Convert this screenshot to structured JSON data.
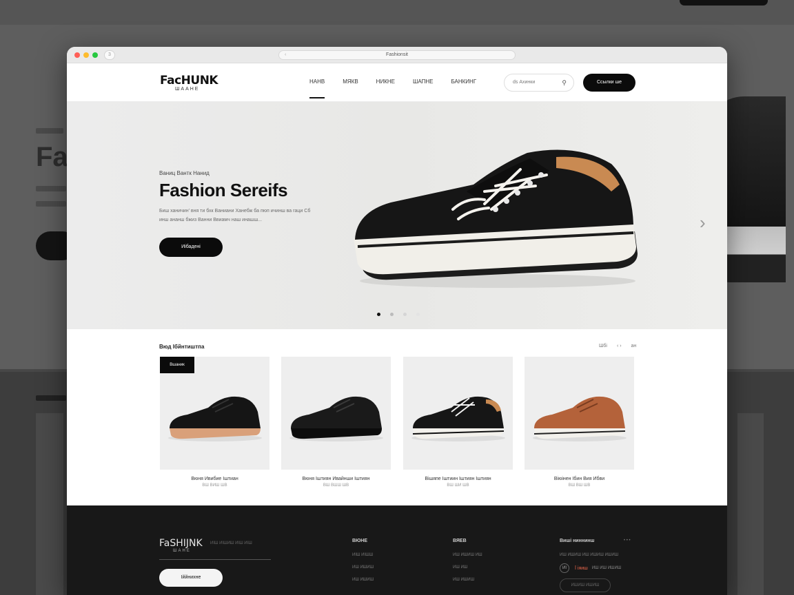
{
  "colors": {
    "brand_black": "#0b0b0b",
    "footer_bg": "#181818",
    "hero_bg": "#ececec",
    "footer_accent": "#e8664a"
  },
  "backdrop": {
    "title": "Fa"
  },
  "browser": {
    "tab_count": "3",
    "url": "Fashionsit"
  },
  "header": {
    "logo": "FaсHUNK",
    "logo_sub": "ШААНЕ",
    "nav": [
      "НАНВ",
      "МЯКВ",
      "НИКНЕ",
      "ШАПНЕ",
      "БАНКИНГ"
    ],
    "search_placeholder": "ds Ахинки",
    "cta_label": "Ссылки ше"
  },
  "hero": {
    "eyebrow": "Ваниц Вантк Нанид",
    "title": "Fashion Sereifs",
    "description": "Биш ханичин' вня ти бхк Ваниани Ханебж ба пюп ичинш ва гаци Сб инш ананш бжиз Ванни Ввиамч наш инашш...",
    "button": "Иібадені",
    "slides_total": 4,
    "slide_active": 1
  },
  "products": {
    "section_title": "Вюд Ібйнтиштпа",
    "links": [
      "Шбі",
      "‹ ›",
      "ан"
    ],
    "badge": "Вшаник",
    "items": [
      {
        "name": "Вюня Ивибие Іштиан",
        "price": "ВШ ВИШ ШВ",
        "shoe": "black-tan-sole"
      },
      {
        "name": "Вюня Іштиян Ивайнши Іштиян",
        "price": "ВШ ВШШ ШВ",
        "shoe": "black-dark-sole"
      },
      {
        "name": "Вішяпе Іштиин Іштиян Іштиян",
        "price": "ВШ ШИ ШВ",
        "shoe": "black-white-lace"
      },
      {
        "name": "Віюінен Ібин Вия Ибви",
        "price": "ВШ ВШ ШВ",
        "shoe": "tan-white-sole"
      }
    ]
  },
  "footer": {
    "logo": "FaSHIJNK",
    "logo_sub": "ШАНЕ",
    "tagline": "ИІШ ИІШИШ ИІШ ИІШ",
    "button": "Іййнихне",
    "columns": [
      {
        "title": "ВЮНЕ",
        "links": [
          "ИІШ ИІШШ",
          "ИШ ИШИШ",
          "ИШ ИШИШ"
        ]
      },
      {
        "title": "ВЯЕВ",
        "links": [
          "ИШ ИШИШ ИШ",
          "ИШ ИШ",
          "ИШ ИШИШ"
        ]
      }
    ],
    "newsletter_title": "Виші ниннинш",
    "newsletter_desc": "ИШ ИШИШ ИШ ИШИШ ИШИШ",
    "social": "• • •",
    "icon_label": "ИІ",
    "accent_text": "Ї іяиш",
    "row_text": "ИШ ИШ ИШИШ",
    "pill": "ИШИШ ИШИШ"
  }
}
